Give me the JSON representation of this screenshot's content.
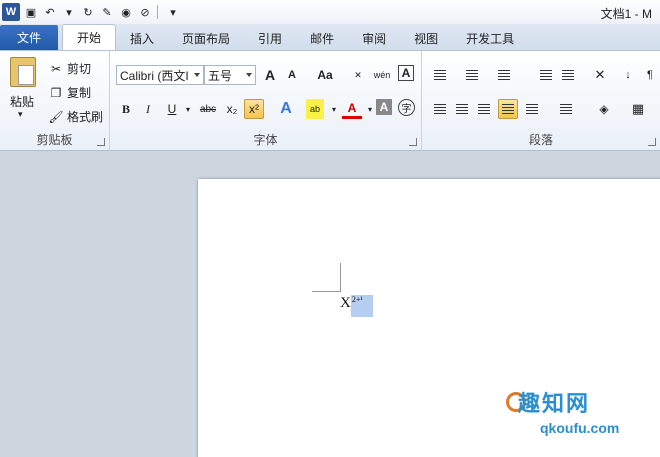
{
  "titlebar": {
    "title": "文档1 - M",
    "logo": "W"
  },
  "tabs": [
    {
      "label": "文件"
    },
    {
      "label": "开始"
    },
    {
      "label": "插入"
    },
    {
      "label": "页面布局"
    },
    {
      "label": "引用"
    },
    {
      "label": "邮件"
    },
    {
      "label": "审阅"
    },
    {
      "label": "视图"
    },
    {
      "label": "开发工具"
    }
  ],
  "clipboard": {
    "paste": "粘贴",
    "cut": "剪切",
    "copy": "复制",
    "format_painter": "格式刷",
    "label": "剪贴板"
  },
  "font": {
    "family": "Calibri (西文I",
    "size": "五号",
    "label": "字体",
    "grow": "A",
    "shrink": "A",
    "case": "Aa",
    "bold": "B",
    "italic": "I",
    "underline": "U",
    "strike": "abc",
    "subscript": "x₂",
    "superscript": "x²",
    "phonetic": "wén",
    "char_border": "A",
    "font_color": "A",
    "char_shade": "A",
    "enclose": "字"
  },
  "paragraph": {
    "label": "段落"
  },
  "document": {
    "base_text": "X",
    "superscript_text": "2+¹"
  },
  "watermark": {
    "text": "趣知网",
    "url": "qkoufu.com"
  },
  "colors": {
    "file_tab": "#2b5fae",
    "accent": "#2b5797",
    "highlight": "#f6c34f",
    "selection": "#b4cdf0"
  }
}
